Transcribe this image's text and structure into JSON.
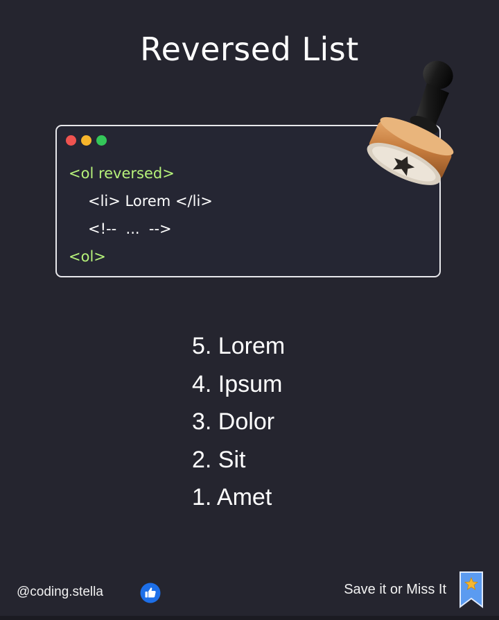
{
  "title": "Reversed List",
  "code": {
    "dot_colors": [
      "#ef5350",
      "#f7b52b",
      "#34c759"
    ],
    "lines": [
      {
        "text": "<ol reversed>",
        "color": "#b6f27a",
        "indent": false
      },
      {
        "text": "<li> Lorem </li>",
        "color": "#ffffff",
        "indent": true
      },
      {
        "text": "<!--  ...  -->",
        "color": "#ffffff",
        "indent": true
      },
      {
        "text": "<ol>",
        "color": "#b6f27a",
        "indent": false
      }
    ]
  },
  "list_items": [
    "5. Lorem",
    "4. Ipsum",
    "3. Dolor",
    "2. Sit",
    "1. Amet"
  ],
  "footer": {
    "handle": "@coding.stella",
    "save_text": "Save it or Miss It"
  },
  "icons": {
    "stamp": "rubber-stamp-icon",
    "like": "thumbs-up-icon",
    "bookmark": "bookmark-star-icon"
  },
  "colors": {
    "background": "#25252f",
    "accent_green": "#b6f27a",
    "like_blue": "#1d6fe8",
    "bookmark_blue": "#5b9bf0"
  }
}
